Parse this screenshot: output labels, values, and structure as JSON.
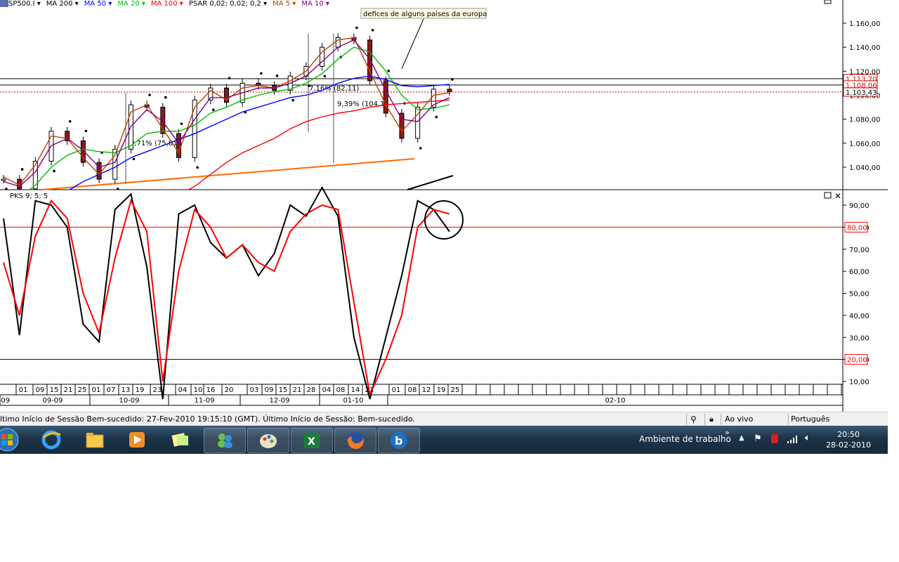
{
  "toolbar": {
    "symbol": "SP500.I",
    "indicators": [
      {
        "label": "MA 200",
        "color": "#000000"
      },
      {
        "label": "MA 50",
        "color": "#0000ff"
      },
      {
        "label": "MA 20",
        "color": "#00c000"
      },
      {
        "label": "MA 100",
        "color": "#ff0000"
      },
      {
        "label": "PSAR 0,02; 0,02; 0,2",
        "color": "#000000"
      },
      {
        "label": "MA 5",
        "color": "#c04000"
      },
      {
        "label": "MA 10",
        "color": "#800080"
      }
    ]
  },
  "annotation": "defices de alguns paises da europa",
  "price_pane": {
    "ticks": [
      "1.160,00",
      "1.140,00",
      "1.120,00",
      "1.100,00",
      "1.080,00",
      "1.060,00",
      "1.040,00"
    ],
    "price_labels": [
      {
        "text": "1.113,70",
        "color": "#ff0000"
      },
      {
        "text": "1.108,06",
        "color": "#ff0000"
      },
      {
        "text": "1.103,43",
        "color": "#000000"
      }
    ],
    "pct_labels": [
      "9,71% (75,81)",
      "7,16% (82,11)",
      "9,39% (104,1)"
    ]
  },
  "osc_pane": {
    "title": "PKS 9; 5; 5",
    "ticks": [
      "90,00",
      "80,00",
      "70,00",
      "60,00",
      "50,00",
      "40,00",
      "30,00",
      "20,00",
      "10,00"
    ],
    "upper_level": "80,00",
    "lower_level": "20,00"
  },
  "time_axis": {
    "days": [
      "01",
      "09",
      "15",
      "21",
      "25",
      "01",
      "07",
      "13",
      "19",
      "23",
      "04",
      "10",
      "16",
      "20",
      "03",
      "09",
      "15",
      "21",
      "28",
      "04",
      "08",
      "14",
      "21",
      "01",
      "08",
      "12",
      "19",
      "25"
    ],
    "months": [
      "-09",
      "09-09",
      "10-09",
      "11-09",
      "12-09",
      "01-10",
      "02-10"
    ]
  },
  "status": {
    "message": "ltimo Início de Sessão Bem-sucedido: 27-Fev-2010 19:15:10 (GMT). Último Início de Sessão: Bem-sucedido.",
    "connection": "Ao vivo",
    "language": "Português"
  },
  "taskbar": {
    "desktop_label": "Ambiente de trabalho",
    "time": "20:50",
    "date": "28-02-2010"
  },
  "chart_data": {
    "type": "line",
    "title": "SP500.I",
    "price_ylim": [
      1025,
      1170
    ],
    "x": [
      "2009-08-27",
      "2009-09-01",
      "2009-09-09",
      "2009-09-15",
      "2009-09-21",
      "2009-09-25",
      "2009-10-01",
      "2009-10-07",
      "2009-10-13",
      "2009-10-19",
      "2009-10-23",
      "2009-11-04",
      "2009-11-10",
      "2009-11-16",
      "2009-11-20",
      "2009-12-03",
      "2009-12-09",
      "2009-12-15",
      "2009-12-21",
      "2009-12-28",
      "2010-01-04",
      "2010-01-08",
      "2010-01-14",
      "2010-01-21",
      "2010-02-01",
      "2010-02-08",
      "2010-02-12",
      "2010-02-19",
      "2010-02-25"
    ],
    "series": [
      {
        "name": "SP500.I",
        "color": "#000000",
        "values": [
          1030,
          1022,
          1045,
          1070,
          1062,
          1044,
          1030,
          1055,
          1092,
          1090,
          1068,
          1048,
          1096,
          1106,
          1094,
          1110,
          1108,
          1104,
          1116,
          1124,
          1140,
          1148,
          1146,
          1112,
          1085,
          1064,
          1090,
          1105,
          1103
        ]
      },
      {
        "name": "MA 20",
        "color": "#00c000",
        "values": [
          1010,
          1015,
          1025,
          1040,
          1050,
          1055,
          1053,
          1052,
          1058,
          1068,
          1070,
          1070,
          1075,
          1085,
          1090,
          1096,
          1100,
          1103,
          1105,
          1110,
          1118,
          1130,
          1140,
          1136,
          1120,
          1100,
          1088,
          1089,
          1092
        ]
      },
      {
        "name": "MA 50",
        "color": "#0000ff",
        "values": [
          992,
          996,
          1002,
          1010,
          1020,
          1028,
          1034,
          1040,
          1048,
          1053,
          1058,
          1063,
          1068,
          1074,
          1080,
          1086,
          1090,
          1094,
          1098,
          1100,
          1104,
          1110,
          1114,
          1116,
          1113,
          1108,
          1107,
          1108,
          1109
        ]
      },
      {
        "name": "MA 100",
        "color": "#ff0000",
        "values": [
          960,
          964,
          970,
          976,
          982,
          988,
          993,
          998,
          1003,
          1008,
          1012,
          1017,
          1024,
          1034,
          1044,
          1052,
          1058,
          1064,
          1072,
          1078,
          1082,
          1085,
          1087,
          1090,
          1092,
          1093,
          1094,
          1095,
          1096
        ]
      },
      {
        "name": "MA 5",
        "color": "#c04000",
        "values": [
          1032,
          1025,
          1042,
          1066,
          1064,
          1048,
          1034,
          1050,
          1086,
          1092,
          1072,
          1052,
          1090,
          1104,
          1096,
          1106,
          1108,
          1106,
          1112,
          1120,
          1136,
          1146,
          1148,
          1120,
          1092,
          1070,
          1084,
          1100,
          1102
        ]
      },
      {
        "name": "MA 10",
        "color": "#800080",
        "values": [
          1028,
          1024,
          1036,
          1058,
          1064,
          1054,
          1040,
          1044,
          1074,
          1088,
          1078,
          1060,
          1080,
          1098,
          1098,
          1102,
          1106,
          1106,
          1110,
          1116,
          1128,
          1140,
          1146,
          1130,
          1104,
          1080,
          1078,
          1092,
          1098
        ]
      }
    ],
    "oscillator": {
      "name": "PKS 9; 5; 5",
      "ylim": [
        0,
        100
      ],
      "levels": [
        80,
        20
      ],
      "series": [
        {
          "name": "%K",
          "color": "#000000",
          "values": [
            84,
            31,
            92,
            90,
            80,
            36,
            28,
            88,
            95,
            62,
            2,
            86,
            90,
            73,
            66,
            72,
            58,
            68,
            90,
            85,
            98,
            85,
            30,
            2,
            30,
            58,
            92,
            88,
            78
          ]
        },
        {
          "name": "%D",
          "color": "#ff0000",
          "values": [
            64,
            40,
            76,
            92,
            84,
            50,
            32,
            66,
            92,
            78,
            10,
            60,
            88,
            80,
            66,
            72,
            64,
            60,
            78,
            86,
            90,
            88,
            46,
            4,
            20,
            40,
            80,
            88,
            86
          ]
        }
      ]
    }
  }
}
